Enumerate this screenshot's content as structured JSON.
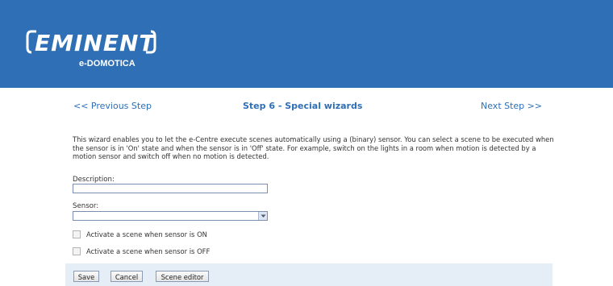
{
  "header": {
    "brand": "EMINENT",
    "sub_brand": "e-DOMOTICA",
    "background_color": "#2f6fb5"
  },
  "nav": {
    "prev_label": "<<  Previous Step",
    "title": "Step 6 - Special wizards",
    "next_label": "Next Step  >>"
  },
  "intro": {
    "text": "This wizard enables you to let the e-Centre execute scenes automatically using a (binary) sensor. You can select a scene to be executed when the sensor is in 'On' state and when the sensor is in 'Off' state. For example, switch on the lights in a room when motion is detected by a motion sensor and switch off when no motion is detected."
  },
  "form": {
    "description_label": "Description:",
    "description_value": "",
    "sensor_label": "Sensor:",
    "sensor_value": "",
    "check_on_label": "Activate a scene when sensor is ON",
    "check_on_checked": false,
    "check_off_label": "Activate a scene when sensor is OFF",
    "check_off_checked": false
  },
  "buttons": {
    "save": "Save",
    "cancel": "Cancel",
    "scene_editor": "Scene editor"
  }
}
